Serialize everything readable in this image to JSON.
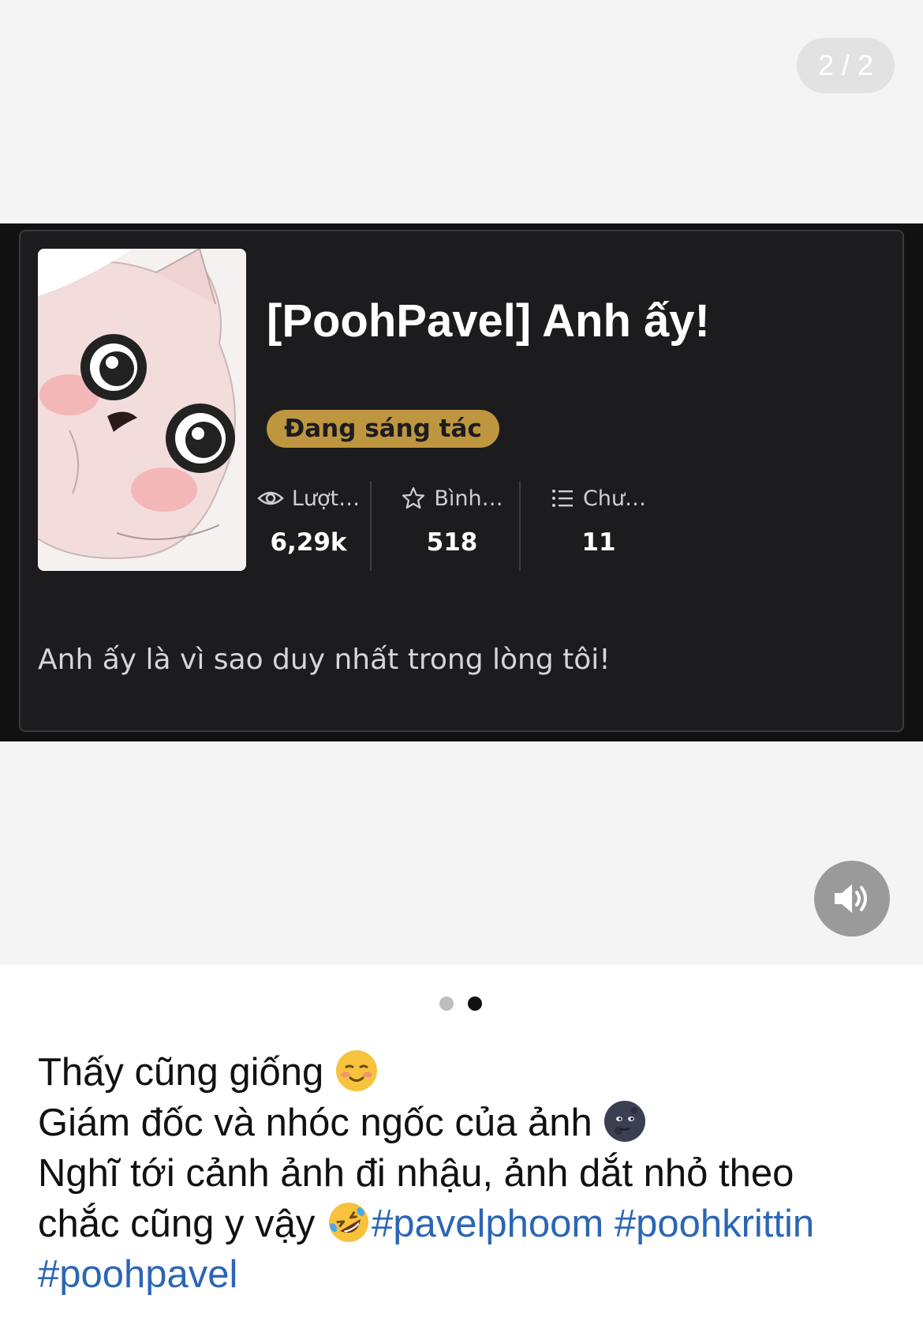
{
  "gallery": {
    "counter": "2 / 2",
    "dots": [
      "inactive",
      "active"
    ]
  },
  "story": {
    "title": "[PoohPavel] Anh ấy!",
    "status_badge": "Đang sáng tác",
    "stats": [
      {
        "label": "Lượt…",
        "value": "6,29k",
        "icon": "eye-icon"
      },
      {
        "label": "Bình…",
        "value": "518",
        "icon": "star-icon"
      },
      {
        "label": "Chư…",
        "value": "11",
        "icon": "list-icon"
      }
    ],
    "description": "Anh ấy là vì sao duy nhất trong lòng tôi!"
  },
  "caption": {
    "line1": "Thấy cũng giống",
    "line2": "Giám đốc và nhóc ngốc của ảnh",
    "line3": "Nghĩ tới cảnh ảnh đi nhậu, ảnh dắt nhỏ theo",
    "line4": "chắc cũng y vậy",
    "hashtags": [
      "#pavelphoom",
      "#poohkrittin",
      "#poohpavel"
    ]
  },
  "colors": {
    "band_bg": "#111111",
    "card_bg": "#1c1c1e",
    "badge": "#bf9640",
    "hashtag": "#2b66b5"
  },
  "icons": {
    "sound": "speaker-icon",
    "emoji1": "smiling-face-emoji",
    "emoji2": "new-moon-face-emoji",
    "emoji3": "rolling-laughing-emoji"
  }
}
